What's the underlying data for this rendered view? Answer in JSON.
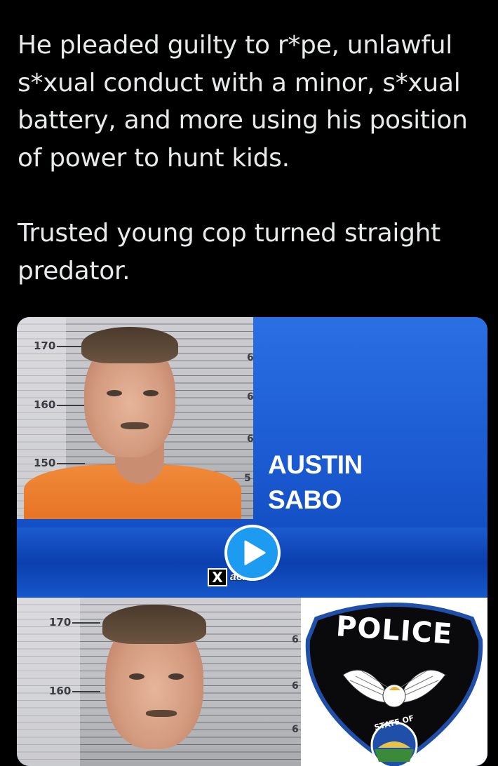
{
  "tweet": {
    "paragraphs": [
      "He pleaded guilty to r*pe, unlawful s*xual conduct with a minor, s*xual battery, and more using his position of power to hunt kids.",
      "Trusted young cop turned straight predator."
    ]
  },
  "media": {
    "top_mugshot": {
      "height_marks": [
        "170",
        "160",
        "150"
      ],
      "side_digits": [
        "6",
        "6",
        "6",
        "5"
      ]
    },
    "name_lines": [
      "AUSTIN",
      "SABO"
    ],
    "watermark_text": "acists",
    "bottom_mugshot": {
      "height_marks": [
        "170",
        "160"
      ],
      "side_digits": [
        "6",
        "6",
        "6"
      ]
    },
    "badge": {
      "title": "POLICE",
      "seal_text": "STATE OF"
    },
    "icons": [
      "play-icon",
      "x-logo-icon"
    ]
  },
  "colors": {
    "background": "#000000",
    "text": "#e7e9ea",
    "banner_blue": "#1a58cf",
    "play_button": "#1d9bf0",
    "shirt_orange": "#e67022"
  }
}
